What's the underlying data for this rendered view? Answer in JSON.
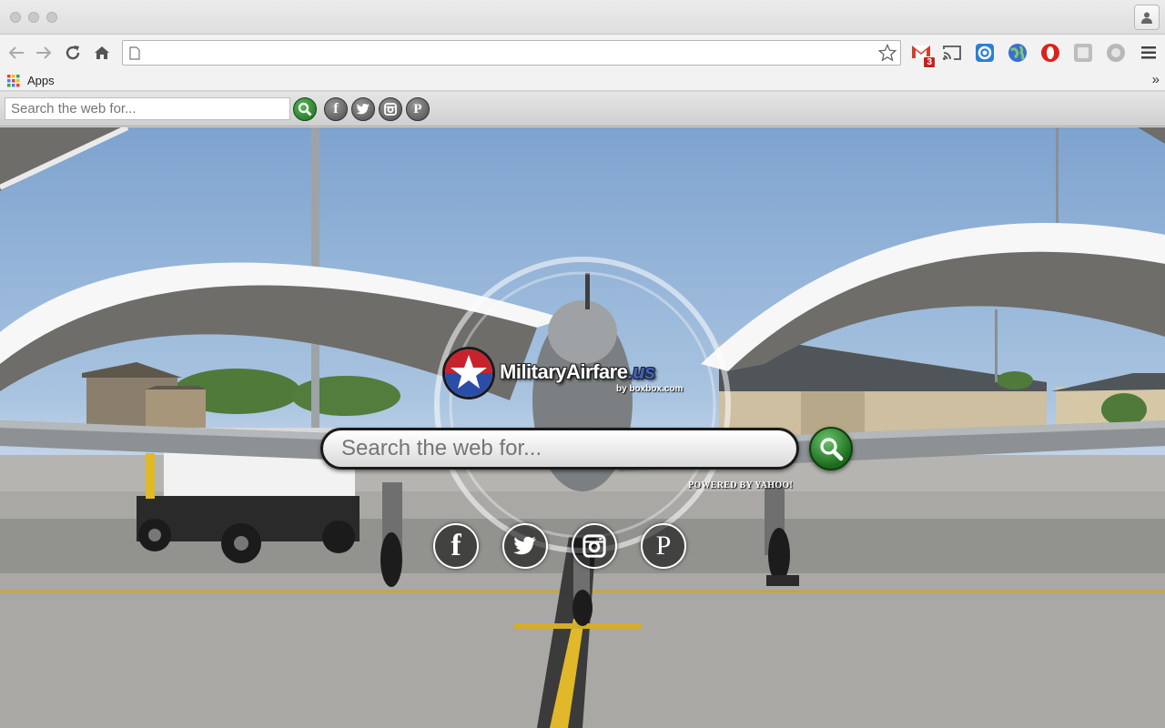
{
  "browser": {
    "address_value": "",
    "bookmarks": {
      "apps_label": "Apps",
      "overflow_label": "»"
    },
    "extensions": [
      {
        "icon": "gmail-icon",
        "badge": "3"
      },
      {
        "icon": "cast-icon"
      },
      {
        "icon": "blue-ring-icon"
      },
      {
        "icon": "globe-icon"
      },
      {
        "icon": "opera-icon"
      },
      {
        "icon": "gray-square-icon"
      },
      {
        "icon": "gray-circle-icon"
      }
    ]
  },
  "toolbar": {
    "search_placeholder": "Search the web for...",
    "social": [
      "facebook",
      "twitter",
      "instagram",
      "pinterest"
    ]
  },
  "main": {
    "logo_name": "MilitaryAirfare",
    "logo_tld": ".us",
    "logo_by": "by boxbox.com",
    "search_placeholder": "Search the web for...",
    "powered_by": "POWERED BY YAHOO!",
    "social_letters": {
      "facebook": "f",
      "pinterest": "P"
    }
  },
  "colors": {
    "go_button": "#2e8b2e",
    "logo_red": "#c8232c",
    "logo_blue": "#2a4ea8"
  }
}
